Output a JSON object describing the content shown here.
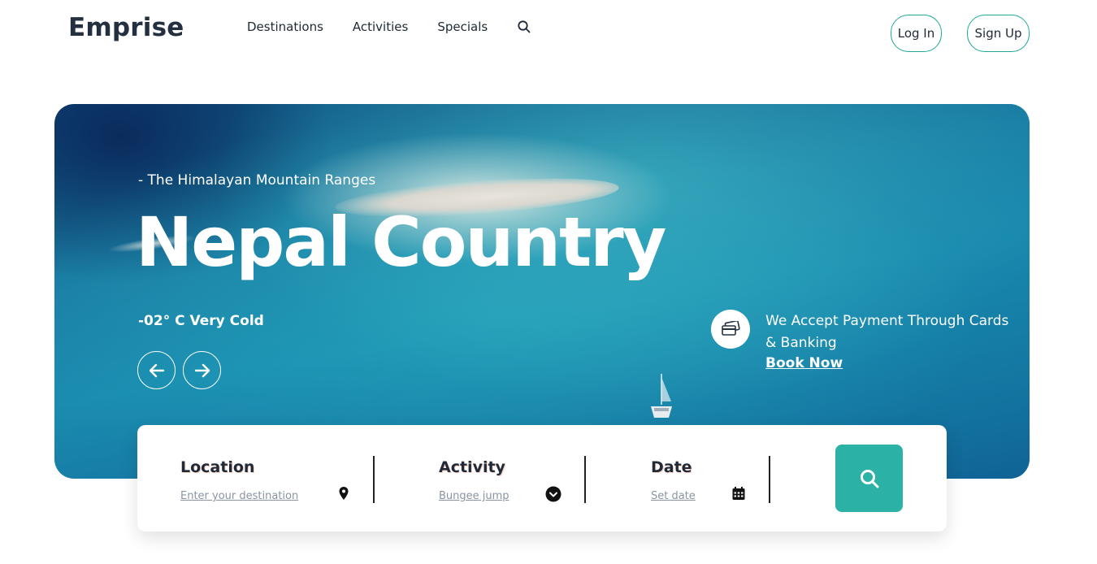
{
  "brand": {
    "name": "Emprise"
  },
  "nav": {
    "items": [
      {
        "label": "Destinations"
      },
      {
        "label": "Activities"
      },
      {
        "label": "Specials"
      }
    ]
  },
  "auth": {
    "login_label": "Log In",
    "signup_label": "Sign Up"
  },
  "hero": {
    "subtitle": "- The Himalayan Mountain Ranges",
    "title": "Nepal Country",
    "temperature": "-02° C Very Cold",
    "payment_text": "We Accept Payment Through Cards & Banking",
    "book_link": "Book Now"
  },
  "search": {
    "location": {
      "label": "Location",
      "value": "Enter your destination"
    },
    "activity": {
      "label": "Activity",
      "value": "Bungee jump"
    },
    "date": {
      "label": "Date",
      "value": "Set date"
    }
  },
  "colors": {
    "accent": "#2bb1a5",
    "outline": "#1fa89a",
    "text_dark": "#243040"
  },
  "icons": [
    "search-icon",
    "arrow-left-icon",
    "arrow-right-icon",
    "credit-card-icon",
    "map-pin-icon",
    "chevron-down-icon",
    "calendar-icon"
  ]
}
